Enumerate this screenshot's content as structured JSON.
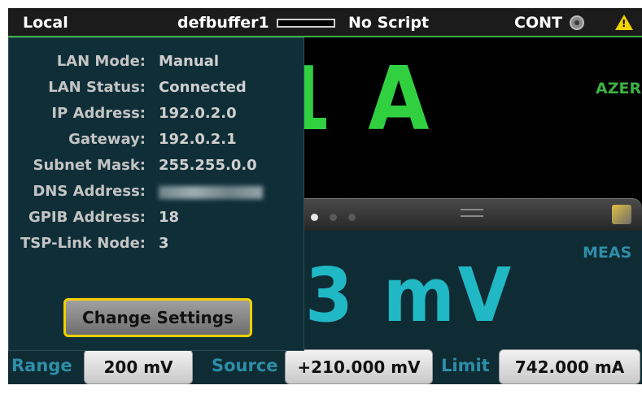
{
  "status_bar": {
    "mode": "Local",
    "buffer": "defbuffer1",
    "script": "No Script",
    "trigger": "CONT"
  },
  "upper_reading": {
    "value_partial": "1 A",
    "azero": "AZERO"
  },
  "lower_panel": {
    "meas_label": "MEAS",
    "value_partial": "3 mV"
  },
  "bottom_bar": {
    "range_label": "Range",
    "range_value": "200 mV",
    "source_label": "Source",
    "source_value": "+210.000 mV",
    "limit_label": "Limit",
    "limit_value": "742.000 mA"
  },
  "popup": {
    "rows": [
      {
        "label": "LAN Mode:",
        "value": "Manual"
      },
      {
        "label": "LAN Status:",
        "value": "Connected"
      },
      {
        "label": "IP Address:",
        "value": "192.0.2.0"
      },
      {
        "label": "Gateway:",
        "value": "192.0.2.1"
      },
      {
        "label": "Subnet Mask:",
        "value": "255.255.0.0"
      },
      {
        "label": "DNS Address:",
        "value": ""
      },
      {
        "label": "GPIB Address:",
        "value": "18"
      },
      {
        "label": "TSP-Link Node:",
        "value": "3"
      }
    ],
    "button_label": "Change Settings"
  }
}
